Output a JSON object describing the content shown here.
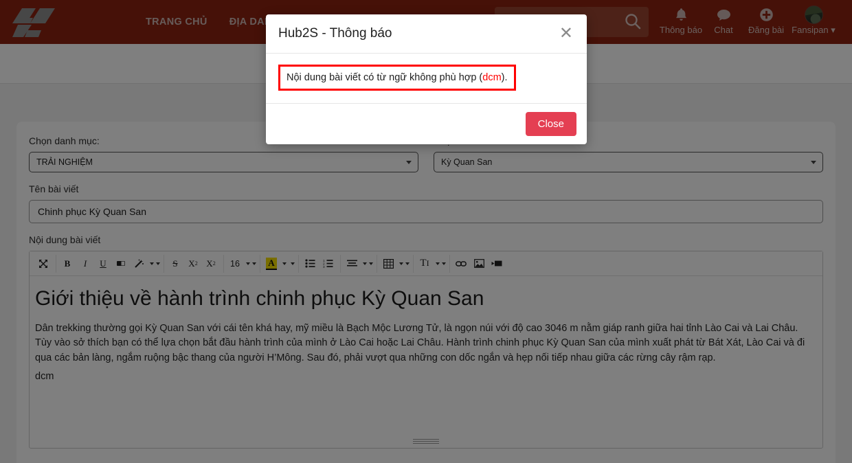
{
  "header": {
    "logo_alt": "Hub2S logo",
    "nav": [
      {
        "label": "TRANG CHỦ",
        "name": "nav-trang-chu"
      },
      {
        "label": "ĐỊA DANH",
        "name": "nav-dia-danh"
      }
    ],
    "search": {
      "value": "",
      "placeholder": ""
    },
    "actions": [
      {
        "label": "Thông báo",
        "icon": "bell-icon",
        "name": "header-notifications"
      },
      {
        "label": "Chat",
        "icon": "chat-bubble-icon",
        "name": "header-chat"
      },
      {
        "label": "Đăng bài",
        "icon": "plus-circle-icon",
        "name": "header-post"
      }
    ],
    "user": {
      "label": "Fansipan",
      "icon": "avatar"
    }
  },
  "form": {
    "category": {
      "label": "Chọn danh mục:",
      "value": "TRẢI NGHIỆM"
    },
    "mountain": {
      "label": "Chọn núi",
      "value": "Kỳ Quan San"
    },
    "title": {
      "label": "Tên bài viết",
      "value": "Chinh phục Kỳ Quan San"
    },
    "content": {
      "label": "Nội dung bài viết"
    }
  },
  "toolbar": {
    "groups": [
      [
        {
          "glyph": "⤧",
          "name": "fullscreen-icon",
          "tri": 0
        }
      ],
      [
        {
          "glyph": "B",
          "name": "bold-button",
          "tri": 0,
          "bold": true
        },
        {
          "glyph": "I",
          "name": "italic-button",
          "tri": 0,
          "italic": true
        },
        {
          "glyph": "U",
          "name": "underline-button",
          "tri": 0,
          "underline": true
        },
        {
          "glyph": "▰",
          "name": "eraser-icon",
          "tri": 0
        },
        {
          "glyph": "✨",
          "name": "magic-wand-icon",
          "tri": 2
        }
      ],
      [
        {
          "glyph": "S",
          "name": "strikethrough-button",
          "tri": 0,
          "strike": true
        },
        {
          "glyph": "X²",
          "name": "superscript-button",
          "tri": 0
        },
        {
          "glyph": "X₂",
          "name": "subscript-button",
          "tri": 0
        }
      ],
      [
        {
          "glyph": "16",
          "name": "font-size-select",
          "tri": 2
        }
      ],
      [
        {
          "glyph": "A",
          "name": "text-color-button",
          "tri": 1,
          "highlight": true
        }
      ],
      [
        {
          "glyph": "☰",
          "name": "bullet-list-button",
          "tri": 0
        },
        {
          "glyph": "☷",
          "name": "numbered-list-button",
          "tri": 0
        }
      ],
      [
        {
          "glyph": "≡",
          "name": "align-button",
          "tri": 2
        }
      ],
      [
        {
          "glyph": "▦",
          "name": "table-icon",
          "tri": 2
        }
      ],
      [
        {
          "glyph": "TI",
          "name": "text-style-button",
          "tri": 2
        }
      ],
      [
        {
          "glyph": "🔗",
          "name": "link-icon",
          "tri": 0
        },
        {
          "glyph": "🖼",
          "name": "image-icon",
          "tri": 0
        },
        {
          "glyph": "▶▮",
          "name": "video-icon",
          "tri": 0
        }
      ]
    ],
    "font_size": "16"
  },
  "document": {
    "heading": "Giới thiệu về hành trình chinh phục Kỳ Quan San",
    "paragraph": "Dân trekking thường gọi Kỳ Quan San với cái tên khá hay, mỹ miều là Bạch Mộc Lương Tử, là ngọn núi với độ cao 3046 m nằm giáp ranh giữa hai tỉnh Lào Cai và Lai Châu. Tùy vào sở thích bạn có thể lựa chọn bắt đầu hành trình của mình ở Lào Cai hoặc Lai Châu. Hành trình chinh phục Kỳ Quan San của mình xuất phát từ Bát Xát, Lào Cai  và đi qua các bản làng, ngắm ruộng bậc thang của người H’Mông. Sau đó, phải vượt qua những con dốc ngắn và hẹp nối tiếp nhau giữa các rừng cây rậm rạp.",
    "extra_line": "dcm"
  },
  "modal": {
    "title": "Hub2S - Thông báo",
    "close_icon": "✕",
    "message_before": "Nội dung bài viết có từ ngữ không phù hợp (",
    "message_flag": "dcm",
    "message_after": ").",
    "close_label": "Close"
  },
  "colors": {
    "brand": "#8c2310",
    "danger": "#e43f52",
    "alert_border": "#ff0000",
    "highlight": "#f2dd00"
  }
}
